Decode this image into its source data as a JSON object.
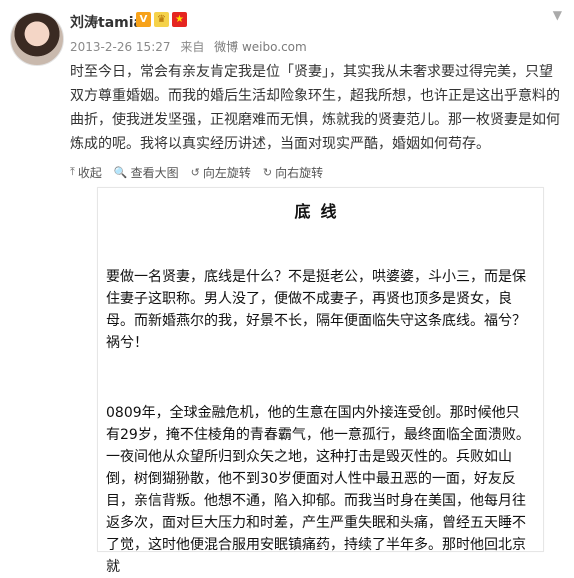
{
  "post": {
    "author": "刘涛tamia",
    "meta": {
      "date": "2013-2-26 15:27",
      "from_label": "来自",
      "source": "微博 weibo.com"
    },
    "text": "时至今日，常会有亲友肯定我是位「贤妻」，其实我从未奢求要过得完美，只望双方尊重婚姻。而我的婚后生活却险象环生，超我所想，也许正是这出乎意料的曲折，使我迸发坚强，正视磨难而无惧，炼就我的贤妻范儿。那一枚贤妻是如何炼成的呢。我将以真实经历讲述，当面对现实严酷，婚姻如何苟存。",
    "toolbar": {
      "collapse": "收起",
      "view_large": "查看大图",
      "rotate_left": "向左旋转",
      "rotate_right": "向右旋转"
    }
  },
  "image_doc": {
    "title": "底线",
    "para1": "要做一名贤妻，底线是什么？不是挺老公，哄婆婆，斗小三，而是保住妻子这职称。男人没了，便做不成妻子，再贤也顶多是贤女，良母。而新婚燕尔的我，好景不长，隔年便面临失守这条底线。福兮？祸兮！",
    "para2": "0809年，全球金融危机，他的生意在国内外接连受创。那时候他只有29岁，掩不住棱角的青春霸气，他一意孤行，最终面临全面溃败。一夜间他从众望所归到众矢之地，这种打击是毁灭性的。兵败如山倒，树倒猢狲散，他不到30岁便面对人性中最丑恶的一面，好友反目，亲信背叛。他想不通，陷入抑郁。而我当时身在美国，他每月往返多次，面对巨大压力和时差，产生严重失眠和头痛，曾经五天睡不了觉，这时他便混合服用安眠镇痛药，持续了半年多。那时他回北京就"
  },
  "icons": [
    "verified-v-icon",
    "crown-icon",
    "china-flag-icon",
    "dropdown-arrow-icon",
    "collapse-icon",
    "zoom-icon",
    "rotate-left-icon",
    "rotate-right-icon"
  ]
}
